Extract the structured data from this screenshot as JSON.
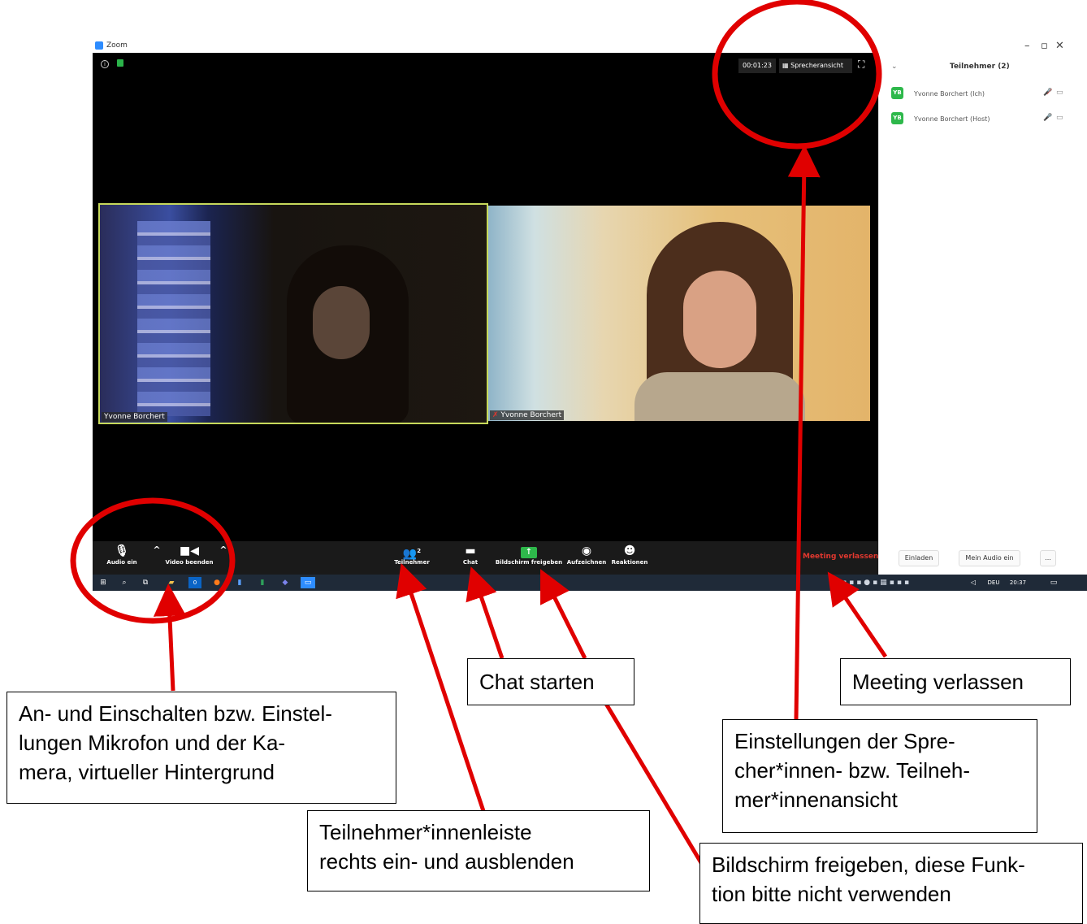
{
  "window": {
    "app_title": "Zoom",
    "controls": [
      "–",
      "▫",
      "✕"
    ]
  },
  "video": {
    "timer": "00:01:23",
    "view_label": "Sprecheransicht",
    "tiles": [
      {
        "name": "Yvonne Borchert"
      },
      {
        "name": "Yvonne Borchert"
      }
    ]
  },
  "toolbar": {
    "audio_label": "Audio ein",
    "video_label": "Video beenden",
    "participants_label": "Teilnehmer",
    "participants_count": "2",
    "chat_label": "Chat",
    "share_label": "Bildschirm freigeben",
    "record_label": "Aufzeichnen",
    "reactions_label": "Reaktionen",
    "leave_label": "Meeting verlassen"
  },
  "panel": {
    "title": "Teilnehmer (2)",
    "participants": [
      {
        "initials": "YB",
        "name": "Yvonne Borchert (Ich)"
      },
      {
        "initials": "YB",
        "name": "Yvonne Borchert (Host)"
      }
    ],
    "invite_label": "Einladen",
    "audio_label": "Mein Audio ein",
    "more_label": "..."
  },
  "taskbar": {
    "language": "DEU",
    "time": "20:37"
  },
  "annotations": {
    "mic_camera": "An- und Einschalten bzw. Einstellungen Mikrofon und der Kamera, virtueller Hintergrund",
    "mic_camera_lines": [
      "An- und Einschalten bzw. Einstel-",
      "lungen Mikrofon und der Ka-",
      "mera, virtueller Hintergrund"
    ],
    "participants_lines": [
      "Teilnehmer*innenleiste",
      "rechts ein- und ausblenden"
    ],
    "chat": "Chat starten",
    "share_lines": [
      "Bildschirm freigeben, diese Funk-",
      "tion bitte nicht verwenden"
    ],
    "leave": "Meeting verlassen",
    "speaker_lines": [
      "Einstellungen der Spre-",
      "cher*innen- bzw. Teilneh-",
      "mer*innenansicht"
    ]
  },
  "colors": {
    "annotation_red": "#e00000",
    "zoom_blue": "#2d8cff",
    "leave_red": "#e0382f",
    "share_green": "#2eb84b",
    "taskbar": "#1f2a38"
  }
}
